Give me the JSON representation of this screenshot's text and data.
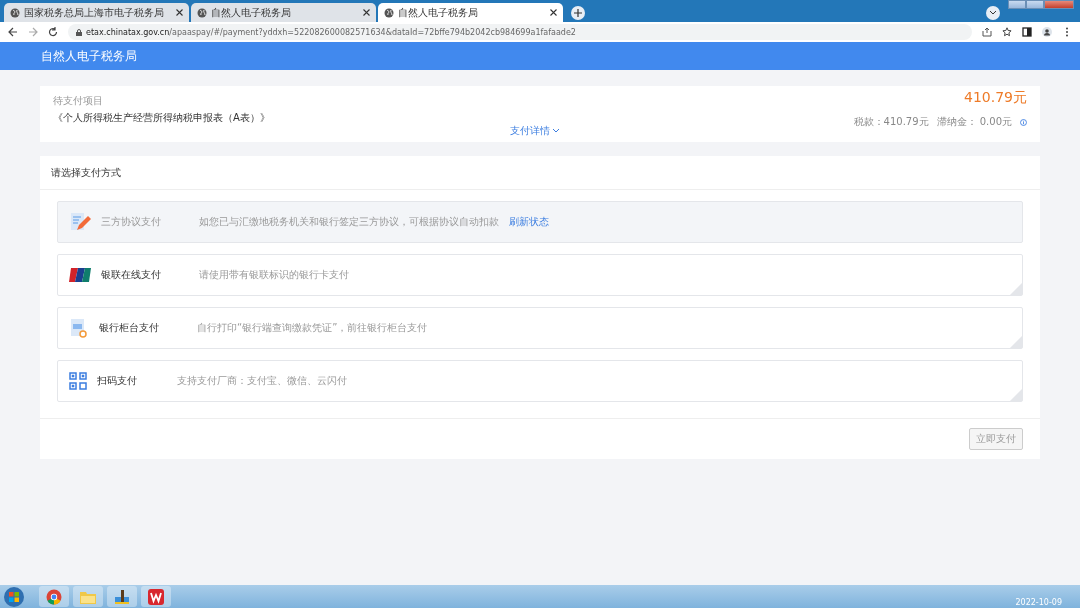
{
  "browser": {
    "tabs": [
      {
        "title": "国家税务总局上海市电子税务局",
        "selected": false
      },
      {
        "title": "自然人电子税务局",
        "selected": false
      },
      {
        "title": "自然人电子税务局",
        "selected": true
      }
    ],
    "url": {
      "host": "etax.chinatax.gov.cn",
      "path": "/apaaspay/#/payment?yddxh=522082600082571634&dataId=72bffe794b2042cb984699a1fafaade2"
    }
  },
  "header": {
    "title": "自然人电子税务局"
  },
  "payment_item": {
    "label": "待支付项目",
    "name": "《个人所得税生产经营所得纳税申报表（A表）》",
    "details_link": "支付详情",
    "amount": "410.79元",
    "breakdown": "税款：410.79元",
    "late_fee": "滞纳金： 0.00元"
  },
  "methods": {
    "title": "请选择支付方式",
    "items": [
      {
        "kind": "agreement",
        "name": "三方协议支付",
        "description": "如您已与汇缴地税务机关和银行签定三方协议，可根据协议自动扣款",
        "link": "刷新状态",
        "disabled": true
      },
      {
        "kind": "unionpay",
        "name": "银联在线支付",
        "description": "请使用带有银联标识的银行卡支付",
        "disabled": false
      },
      {
        "kind": "counter",
        "name": "银行柜台支付",
        "description": "自行打印“银行端查询缴款凭证”，前往银行柜台支付",
        "disabled": false
      },
      {
        "kind": "qrcode",
        "name": "扫码支付",
        "description": "支持支付厂商：支付宝、微信、云闪付",
        "disabled": false
      }
    ],
    "pay_button": "立即支付"
  },
  "taskbar": {
    "date": "2022-10-09"
  }
}
